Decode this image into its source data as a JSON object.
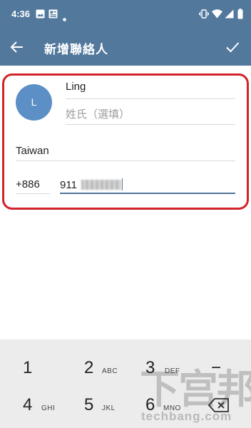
{
  "status_bar": {
    "time": "4:36",
    "icons": [
      "image-icon",
      "news-icon",
      "dot-icon",
      "vibrate-icon",
      "wifi-icon",
      "signal-icon",
      "battery-icon"
    ]
  },
  "app_bar": {
    "title": "新增聯絡人",
    "back_icon": "arrow-left-icon",
    "confirm_icon": "check-icon",
    "color": "#52789c"
  },
  "form": {
    "avatar_initial": "L",
    "first_name_value": "Ling",
    "last_name_placeholder": "姓氏（選填）",
    "country_value": "Taiwan",
    "country_code_value": "+886",
    "phone_value": "911",
    "highlight_color": "#d2232a"
  },
  "keypad": {
    "keys": [
      {
        "digit": "1",
        "letters": ""
      },
      {
        "digit": "2",
        "letters": "ABC"
      },
      {
        "digit": "3",
        "letters": "DEF"
      },
      {
        "digit": "4",
        "letters": "GHI"
      },
      {
        "digit": "5",
        "letters": "JKL"
      },
      {
        "digit": "6",
        "letters": "MNO"
      }
    ],
    "minus_symbol": "−",
    "backspace_icon": "backspace-icon"
  },
  "watermark": {
    "logo_text": "下宫邦",
    "site": "techbang.com"
  }
}
